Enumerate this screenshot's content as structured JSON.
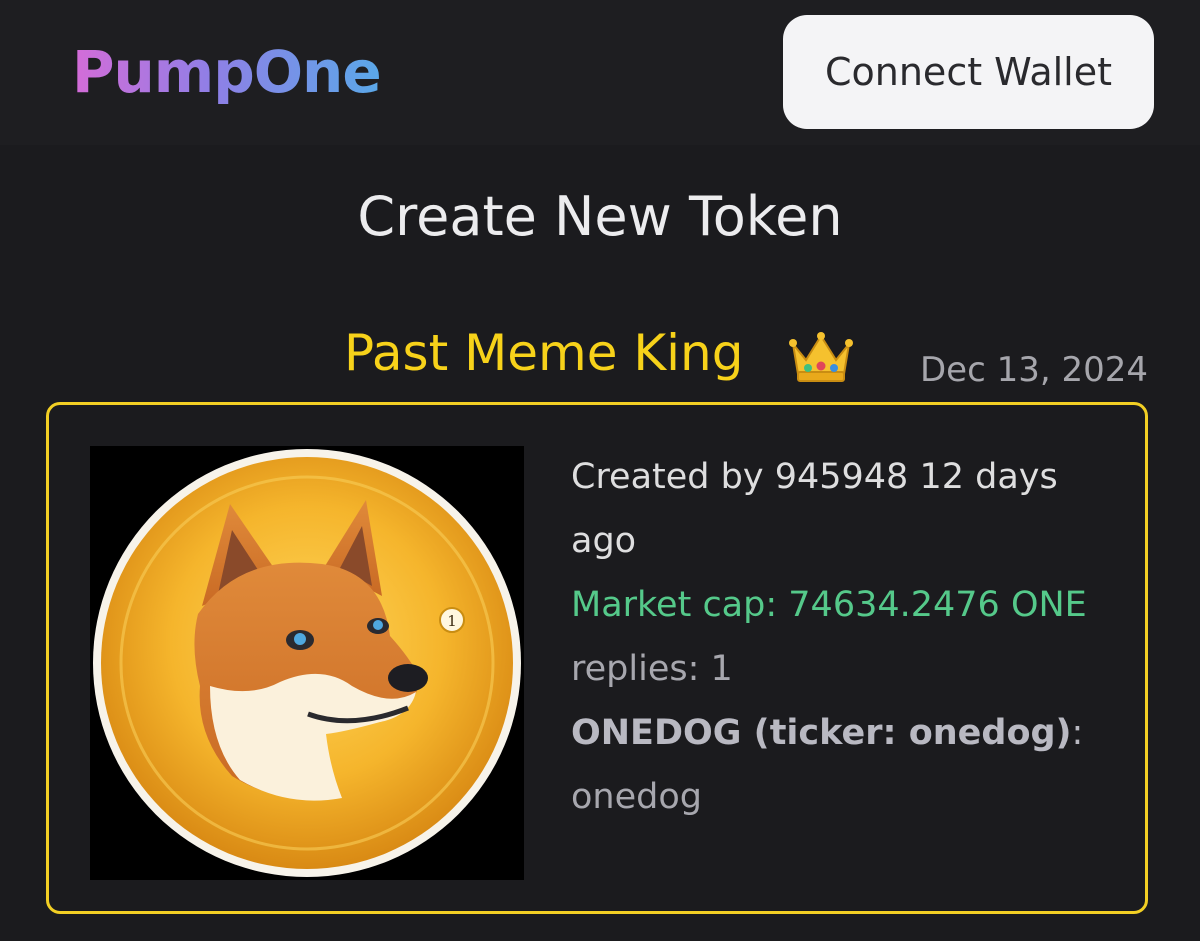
{
  "header": {
    "logo": "PumpOne",
    "connect_label": "Connect Wallet"
  },
  "main": {
    "title": "Create New Token"
  },
  "king": {
    "label": "Past Meme King",
    "icon": "crown-icon",
    "date": "Dec 13, 2024"
  },
  "token": {
    "created_prefix": "Created by",
    "creator": "945948",
    "created_ago": "12 days ago",
    "market_cap_label": "Market cap:",
    "market_cap_value": "74634.2476 ONE",
    "replies_label": "replies:",
    "replies_count": "1",
    "name": "ONEDOG",
    "ticker_label": "ticker:",
    "ticker": "onedog",
    "description": "onedog",
    "image": "onedog-shiba-coin",
    "coin_badge": "1"
  },
  "colors": {
    "background": "#1b1b1e",
    "accent_gold": "#f7d21a",
    "card_border": "#f2cf24",
    "market_cap_green": "#55c98a"
  }
}
